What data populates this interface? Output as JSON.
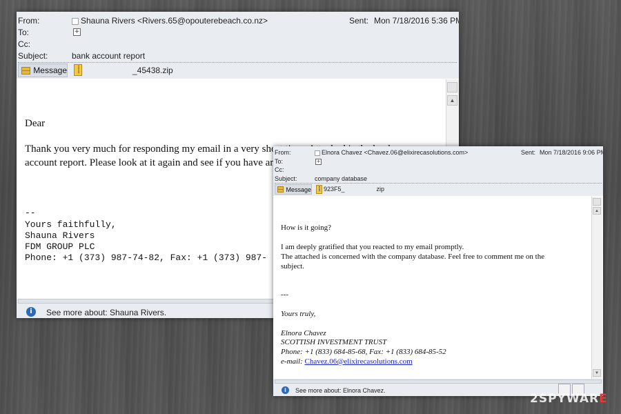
{
  "email1": {
    "labels": {
      "from": "From:",
      "to": "To:",
      "cc": "Cc:",
      "subject": "Subject:",
      "sent": "Sent:"
    },
    "from": "Shauna Rivers <Rivers.65@opouterebeach.co.nz>",
    "sent_value": "Mon 7/18/2016 5:36 PM",
    "subject": "bank account report",
    "message_tab": "Message",
    "attachment": "_45438.zip",
    "body": {
      "greeting": "Dear",
      "paragraph_line1": "Thank you very much for responding my email in a very short time. Attached is the bank",
      "paragraph_line2": "account report. Please look at it again and see if you have any questions.",
      "sig_dash": "--",
      "sig_close": "Yours faithfully,",
      "sig_name": "Shauna Rivers",
      "sig_company": "FDM GROUP PLC",
      "sig_phone": "Phone: +1 (373) 987-74-82, Fax: +1 (373) 987-"
    },
    "footer": "See more about: Shauna Rivers."
  },
  "email2": {
    "labels": {
      "from": "From:",
      "to": "To:",
      "cc": "Cc:",
      "subject": "Subject:",
      "sent": "Sent:"
    },
    "from": "Elnora Chavez <Chavez.06@elixirecasolutions.com>",
    "sent_value": "Mon 7/18/2016 9:06 PM",
    "subject": "company database",
    "message_tab": "Message",
    "attachment_prefix": "923F5_",
    "attachment_ext": "zip",
    "body": {
      "greeting": "How is it going?",
      "line1": "I am deeply gratified that you reacted to my email promptly.",
      "line2": "The attached is concerned with the company database. Feel free to comment me on the",
      "line3": "subject.",
      "sig_dash": "---",
      "sig_close": "Yours truly,",
      "sig_name": "Elnora Chavez",
      "sig_company": "SCOTTISH INVESTMENT TRUST",
      "sig_phone": "Phone: +1 (833) 684-85-68, Fax: +1 (833) 684-85-52",
      "sig_email_label": "e-mail: ",
      "sig_email": "Chavez.06@elixirecasolutions.com"
    },
    "footer": "See more about: Elnora Chavez."
  },
  "watermark": {
    "prefix": "2SPYWAR",
    "suffix": "E"
  },
  "icons": [
    "envelope-icon",
    "zip-file-icon",
    "info-icon",
    "scroll-up-icon",
    "scroll-down-icon",
    "add-recipient-icon"
  ],
  "colors": {
    "header_bg": "#e9edf2",
    "info_blue": "#2d69b8",
    "link": "#1a22c9",
    "background": "#4f4f4f"
  }
}
